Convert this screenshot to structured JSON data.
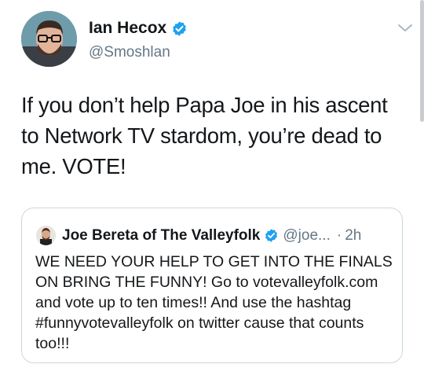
{
  "tweet": {
    "author_name": "Ian Hecox",
    "author_handle": "@Smoshlan",
    "text": "If you don’t help Papa Joe in his ascent to Network TV stardom, you’re dead to me. VOTE!"
  },
  "quoted_tweet": {
    "author_name": "Joe Bereta of The Valleyfolk",
    "author_handle": "@joe...",
    "separator": "·",
    "timestamp": "2h",
    "text": "WE NEED YOUR HELP TO GET INTO THE FINALS ON BRING THE FUNNY! Go to votevalleyfolk.com and vote up to ten times!! And use the hashtag #funnyvotevalleyfolk on twitter cause that counts too!!!"
  },
  "colors": {
    "verified": "#1da1f2",
    "secondary_text": "#657786",
    "border": "#ccd6dd"
  },
  "icons": [
    "verified-badge-icon",
    "chevron-down-icon"
  ]
}
